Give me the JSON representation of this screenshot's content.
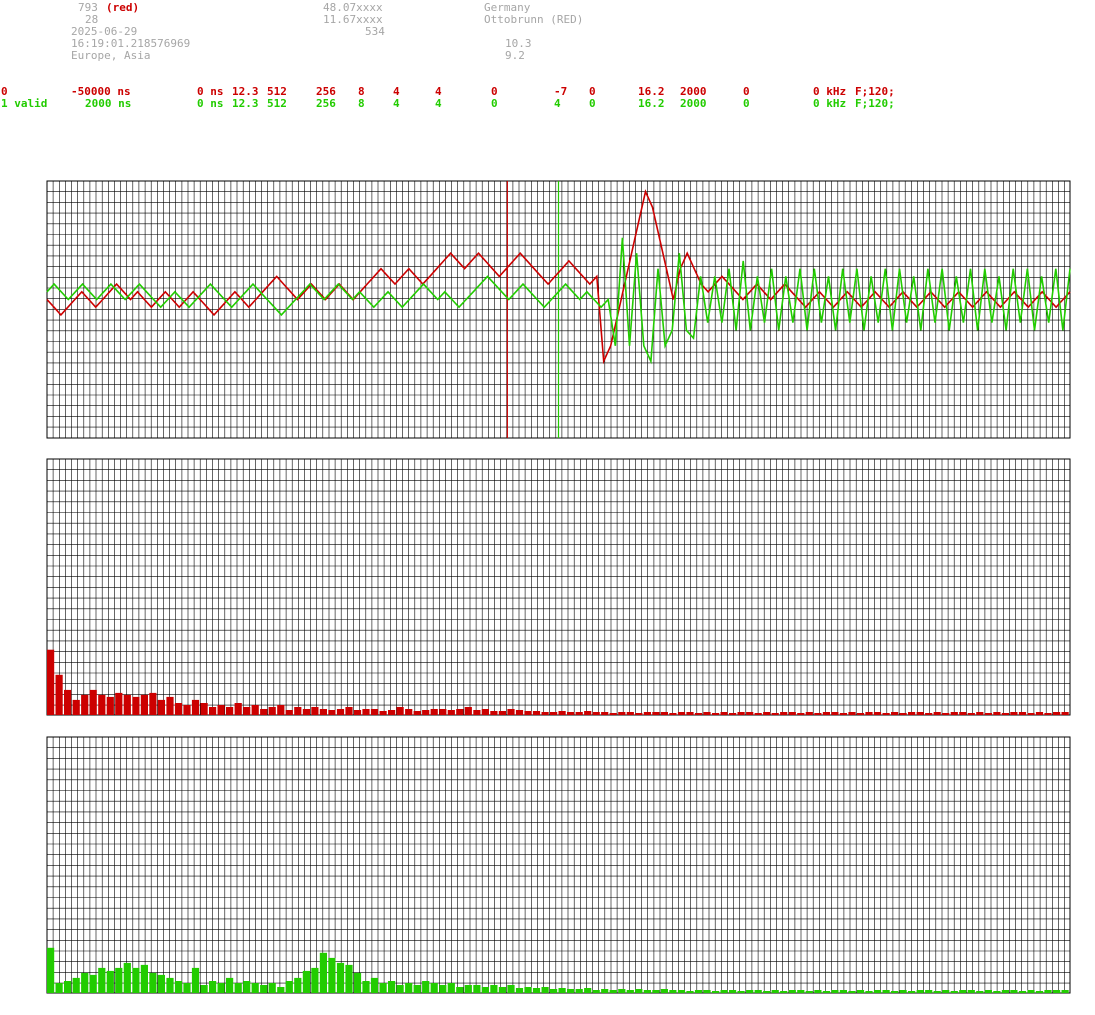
{
  "header": {
    "id": "793",
    "id_tag": "(red)",
    "count": "28",
    "date": "2025-06-29",
    "time": "16:19:01.218576969",
    "region": "Europe, Asia",
    "lat": "48.07xxxx",
    "lon": "11.67xxxx",
    "num": "534",
    "country": "Germany",
    "station": "Ottobrunn (RED)",
    "val1": "10.3",
    "val2": "9.2"
  },
  "rows": [
    {
      "f": [
        "0",
        "-50000 ns",
        "0 ns",
        "12.3",
        "512",
        "256",
        "8",
        "4",
        "4",
        "0",
        "-7",
        "0",
        "16.2",
        "2000",
        "0",
        "0 kHz",
        "F;120;"
      ]
    },
    {
      "f": [
        "1 valid",
        "2000 ns",
        "0 ns",
        "12.3",
        "512",
        "256",
        "8",
        "4",
        "4",
        "0",
        "4",
        "0",
        "16.2",
        "2000",
        "0",
        "0 kHz",
        "F;120;"
      ]
    }
  ],
  "colors": {
    "red": "#cc0000",
    "green": "#22cc00",
    "grid": "#000000",
    "text_gray": "#a6a6a6"
  },
  "chart_data": [
    {
      "type": "line",
      "series": [
        {
          "color": "#cc0000",
          "values": [
            0,
            -1,
            -2,
            -1,
            0,
            1,
            0,
            -1,
            0,
            1,
            2,
            1,
            0,
            1,
            0,
            -1,
            0,
            1,
            0,
            -1,
            0,
            1,
            0,
            -1,
            -2,
            -1,
            0,
            1,
            0,
            -1,
            0,
            1,
            2,
            3,
            2,
            1,
            0,
            1,
            2,
            1,
            0,
            1,
            2,
            1,
            0,
            1,
            2,
            3,
            4,
            3,
            2,
            3,
            4,
            3,
            2,
            3,
            4,
            5,
            6,
            5,
            4,
            5,
            6,
            5,
            4,
            3,
            4,
            5,
            6,
            5,
            4,
            3,
            2,
            3,
            4,
            5,
            4,
            3,
            2,
            3,
            -8,
            -6,
            -2,
            2,
            6,
            10,
            14,
            12,
            8,
            4,
            0,
            4,
            6,
            4,
            2,
            1,
            2,
            3,
            2,
            1,
            0,
            1,
            2,
            1,
            0,
            1,
            2,
            1,
            0,
            -1,
            0,
            1,
            0,
            -1,
            0,
            1,
            0,
            -1,
            0,
            1,
            0,
            -1,
            0,
            1,
            0,
            -1,
            0,
            1,
            0,
            -1,
            0,
            1,
            0,
            -1,
            0,
            1,
            0,
            -1,
            0,
            1,
            0,
            -1,
            0,
            1,
            0,
            -1,
            0,
            1
          ]
        },
        {
          "color": "#22cc00",
          "values": [
            1,
            2,
            1,
            0,
            1,
            2,
            1,
            0,
            1,
            2,
            1,
            0,
            1,
            2,
            1,
            0,
            -1,
            0,
            1,
            0,
            -1,
            0,
            1,
            2,
            1,
            0,
            -1,
            0,
            1,
            2,
            1,
            0,
            -1,
            -2,
            -1,
            0,
            1,
            2,
            1,
            0,
            1,
            2,
            1,
            0,
            1,
            0,
            -1,
            0,
            1,
            0,
            -1,
            0,
            1,
            2,
            1,
            0,
            1,
            0,
            -1,
            0,
            1,
            2,
            3,
            2,
            1,
            0,
            1,
            2,
            1,
            0,
            -1,
            0,
            1,
            2,
            1,
            0,
            1,
            0,
            -1,
            0,
            -6,
            8,
            -6,
            6,
            -6,
            -8,
            4,
            -6,
            -4,
            6,
            -4,
            -5,
            3,
            -3,
            3,
            -3,
            4,
            -4,
            5,
            -4,
            3,
            -3,
            4,
            -4,
            3,
            -3,
            4,
            -4,
            4,
            -3,
            3,
            -4,
            4,
            -3,
            4,
            -4,
            3,
            -3,
            4,
            -4,
            4,
            -3,
            3,
            -4,
            4,
            -3,
            4,
            -4,
            3,
            -3,
            4,
            -4,
            4,
            -3,
            3,
            -4,
            4,
            -3,
            4,
            -4,
            3,
            -3,
            4,
            -4,
            4
          ]
        }
      ],
      "ylim": [
        -15,
        15
      ],
      "markers": [
        {
          "x": 0.45,
          "color": "#cc0000"
        },
        {
          "x": 0.5,
          "color": "#22cc00"
        }
      ]
    },
    {
      "type": "bar",
      "color": "#cc0000",
      "values": [
        65,
        40,
        25,
        15,
        20,
        25,
        20,
        18,
        22,
        20,
        18,
        20,
        22,
        15,
        18,
        12,
        10,
        15,
        12,
        8,
        10,
        8,
        12,
        8,
        10,
        6,
        8,
        10,
        5,
        8,
        6,
        8,
        6,
        5,
        6,
        8,
        5,
        6,
        6,
        4,
        5,
        8,
        6,
        4,
        5,
        6,
        6,
        5,
        6,
        8,
        5,
        6,
        4,
        4,
        6,
        5,
        4,
        4,
        3,
        3,
        4,
        3,
        3,
        4,
        3,
        3,
        2,
        3,
        3,
        2,
        3,
        3,
        3,
        2,
        3,
        3,
        2,
        3,
        2,
        3,
        2,
        3,
        3,
        2,
        3,
        2,
        3,
        3,
        2,
        3,
        2,
        3,
        3,
        2,
        3,
        2,
        3,
        3,
        2,
        3,
        2,
        3,
        3,
        2,
        3,
        2,
        3,
        3,
        2,
        3,
        2,
        3,
        2,
        3,
        3,
        2,
        3,
        2,
        3,
        3
      ],
      "ylim": [
        0,
        255
      ]
    },
    {
      "type": "bar",
      "color": "#22cc00",
      "values": [
        45,
        10,
        12,
        15,
        20,
        18,
        25,
        22,
        25,
        30,
        25,
        28,
        20,
        18,
        15,
        12,
        10,
        25,
        8,
        12,
        10,
        15,
        10,
        12,
        10,
        8,
        10,
        6,
        12,
        15,
        22,
        25,
        40,
        35,
        30,
        28,
        20,
        12,
        15,
        10,
        12,
        8,
        10,
        8,
        12,
        10,
        8,
        10,
        6,
        8,
        8,
        6,
        8,
        6,
        8,
        5,
        6,
        5,
        6,
        4,
        5,
        4,
        4,
        5,
        3,
        4,
        3,
        4,
        3,
        4,
        3,
        3,
        4,
        3,
        3,
        2,
        3,
        3,
        2,
        3,
        3,
        2,
        3,
        3,
        2,
        3,
        2,
        3,
        3,
        2,
        3,
        2,
        3,
        3,
        2,
        3,
        2,
        3,
        3,
        2,
        3,
        2,
        3,
        3,
        2,
        3,
        2,
        3,
        3,
        2,
        3,
        2,
        3,
        3,
        2,
        3,
        2,
        3,
        3,
        3
      ],
      "ylim": [
        0,
        255
      ]
    }
  ]
}
